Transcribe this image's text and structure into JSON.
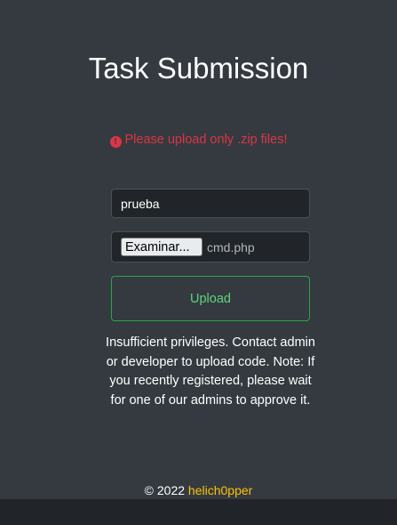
{
  "page": {
    "title": "Task Submission"
  },
  "alert": {
    "icon": "exclamation-circle-icon",
    "message": "Please upload only .zip files!",
    "color": "#dc3545"
  },
  "form": {
    "name_value": "prueba",
    "file_button_label": "Examinar...",
    "file_name": "cmd.php",
    "upload_label": "Upload",
    "upload_color": "#28a745"
  },
  "notice": {
    "text": "Insufficient privileges. Contact admin or developer to upload code. Note: If you recently registered, please wait for one of our admins to approve it."
  },
  "footer": {
    "copyright": "© 2022",
    "author": "helich0pper",
    "author_color": "#ffc107"
  }
}
